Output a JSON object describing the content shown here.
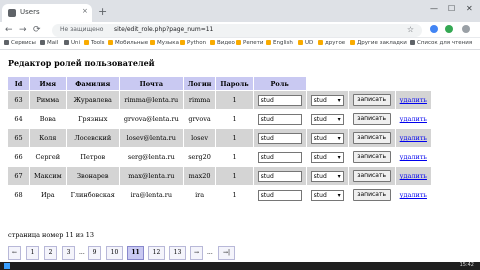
{
  "browser": {
    "tab_title": "Users",
    "tab_close": "×",
    "new_tab": "+",
    "window_controls": [
      "—",
      "☐",
      "✕"
    ],
    "nav_back": "←",
    "nav_forward": "→",
    "nav_reload": "⟳",
    "security_label": "Не защищено",
    "url": "site/edit_role.php?page_num=11",
    "star": "☆",
    "bookmarks": [
      "Сервисы",
      "Mail",
      "Uni",
      "Tools",
      "Мобильные",
      "Музыка",
      "Python",
      "Видео",
      "Репети",
      "English",
      "UD",
      "другое",
      "Другие закладки",
      "Список для чтения"
    ]
  },
  "page": {
    "heading": "Редактор ролей пользователей",
    "table": {
      "headers": [
        "Id",
        "Имя",
        "Фамилия",
        "Почта",
        "Логин",
        "Пароль",
        "Роль"
      ],
      "rows": [
        {
          "id": "63",
          "first": "Римма",
          "last": "Журавлева",
          "email": "rimma@lenta.ru",
          "login": "rimma",
          "password": "1",
          "role": "stud",
          "select": "stud",
          "save": "записать",
          "delete": "удалить"
        },
        {
          "id": "64",
          "first": "Вова",
          "last": "Грязных",
          "email": "grvova@lenta.ru",
          "login": "grvova",
          "password": "1",
          "role": "stud",
          "select": "stud",
          "save": "записать",
          "delete": "удалить"
        },
        {
          "id": "65",
          "first": "Коля",
          "last": "Лосевский",
          "email": "losev@lenta.ru",
          "login": "losev",
          "password": "1",
          "role": "stud",
          "select": "stud",
          "save": "записать",
          "delete": "удалить"
        },
        {
          "id": "66",
          "first": "Сергей",
          "last": "Петров",
          "email": "serg@lenta.ru",
          "login": "serg20",
          "password": "1",
          "role": "stud",
          "select": "stud",
          "save": "записать",
          "delete": "удалить"
        },
        {
          "id": "67",
          "first": "Максим",
          "last": "Звонарев",
          "email": "max@lenta.ru",
          "login": "max20",
          "password": "1",
          "role": "stud",
          "select": "stud",
          "save": "записать",
          "delete": "удалить"
        },
        {
          "id": "68",
          "first": "Ира",
          "last": "Глинбовская",
          "email": "ira@lenta.ru",
          "login": "ira",
          "password": "1",
          "role": "stud",
          "select": "stud",
          "save": "записать",
          "delete": "удалить"
        }
      ]
    },
    "page_info": "страница номер 11 из 13",
    "pagination": {
      "items": [
        "←",
        "1",
        "2",
        "3",
        "...",
        "9",
        "10",
        "11",
        "12",
        "13",
        "→",
        "...",
        "→|"
      ],
      "current": "11"
    }
  },
  "taskbar": {
    "clock": "15:42"
  },
  "colors": {
    "header_bg": "#c9c9f2",
    "row_odd_bg": "#d4d4d4",
    "link": "#0000ee"
  }
}
